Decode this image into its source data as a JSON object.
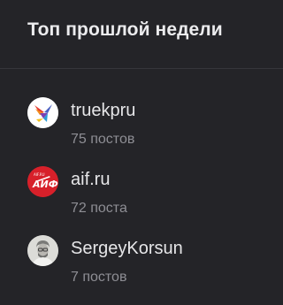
{
  "widget": {
    "title": "Топ прошлой недели",
    "items": [
      {
        "name": "truekpru",
        "count": "75 постов",
        "avatar_icon": "truekp-bird-logo-icon",
        "avatar_bg": "#ffffff"
      },
      {
        "name": "aif.ru",
        "count": "72 поста",
        "avatar_icon": "aif-logo-icon",
        "avatar_bg": "#d7202a",
        "avatar_logo_text": "АИФ",
        "avatar_logo_small_text": "AIF.RU"
      },
      {
        "name": "SergeyKorsun",
        "count": "7 постов",
        "avatar_icon": "user-photo-avatar",
        "avatar_bg": "#d9d9d6"
      }
    ]
  },
  "colors": {
    "background": "#242428",
    "divider": "#36363b",
    "primary_text": "#e6e6e8",
    "secondary_text": "#8e8e94"
  }
}
